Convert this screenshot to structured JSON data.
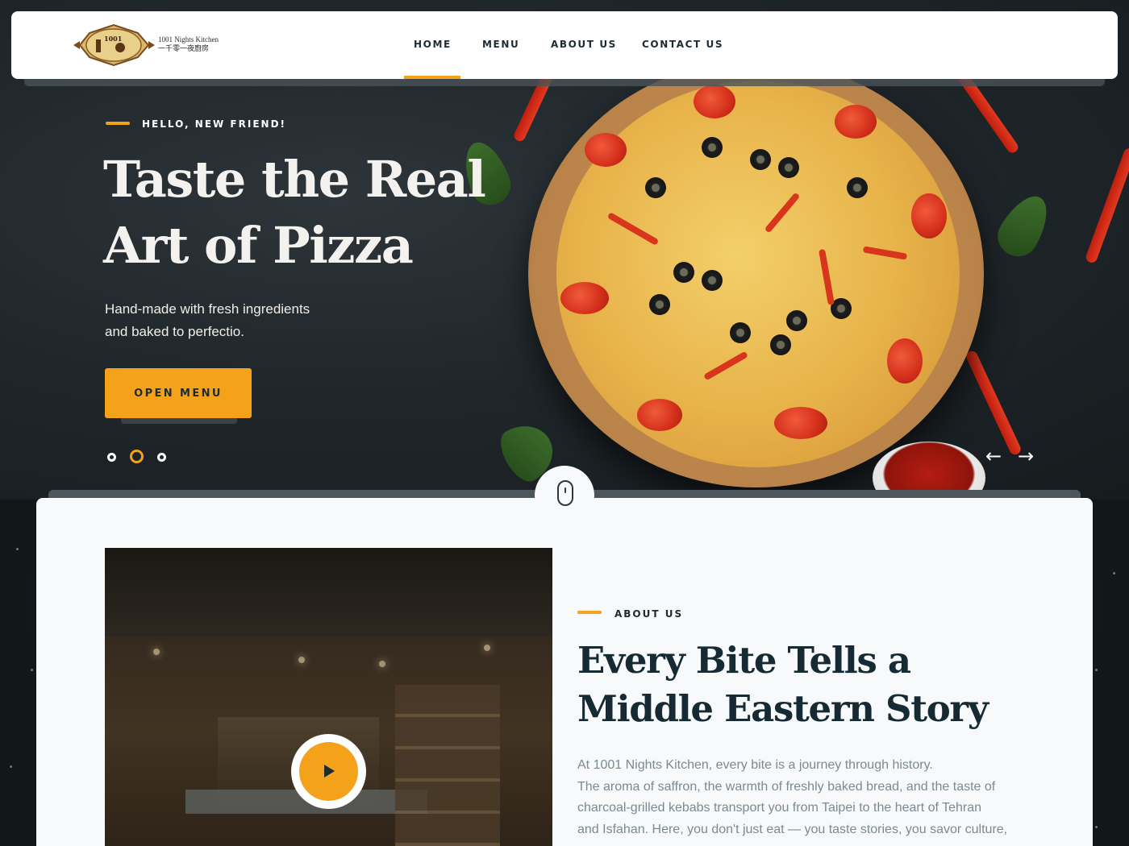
{
  "brand": {
    "logo_alt": "1001 Nights",
    "name_en": "1001 Nights Kitchen",
    "name_zh": "一千零一夜廚房"
  },
  "nav": {
    "items": [
      {
        "label": "HOME",
        "active": true
      },
      {
        "label": "MENU",
        "active": false
      },
      {
        "label": "ABOUT US",
        "active": false
      },
      {
        "label": "CONTACT US",
        "active": false
      }
    ]
  },
  "hero": {
    "eyebrow": "HELLO, NEW FRIEND!",
    "title_line1": "Taste the Real",
    "title_line2": "Art of Pizza",
    "subtitle_line1": "Hand-made with fresh ingredients",
    "subtitle_line2": "and baked to perfectio.",
    "cta_label": "OPEN MENU",
    "slider": {
      "count": 3,
      "active_index": 1
    },
    "prev_arrow": "←",
    "next_arrow": "→"
  },
  "about": {
    "eyebrow": "ABOUT US",
    "title_line1": "Every Bite Tells a",
    "title_line2": "Middle Eastern Story",
    "body_lines": [
      "At 1001 Nights Kitchen, every bite is a journey through history.",
      "The aroma of saffron, the warmth of freshly baked bread, and the taste of",
      "charcoal-grilled kebabs transport you from Taipei to the heart of Tehran",
      "and Isfahan. Here, you don't just eat — you taste stories, you savor culture,"
    ]
  },
  "colors": {
    "accent": "#f5a21b",
    "dark": "#1d2b33",
    "hero_bg": "#20272b",
    "card_bg": "#f8f9fa",
    "body_text": "#7a8a92"
  },
  "icons": {
    "scroll": "mouse-icon",
    "play": "play-icon",
    "prev": "arrow-left-icon",
    "next": "arrow-right-icon"
  }
}
